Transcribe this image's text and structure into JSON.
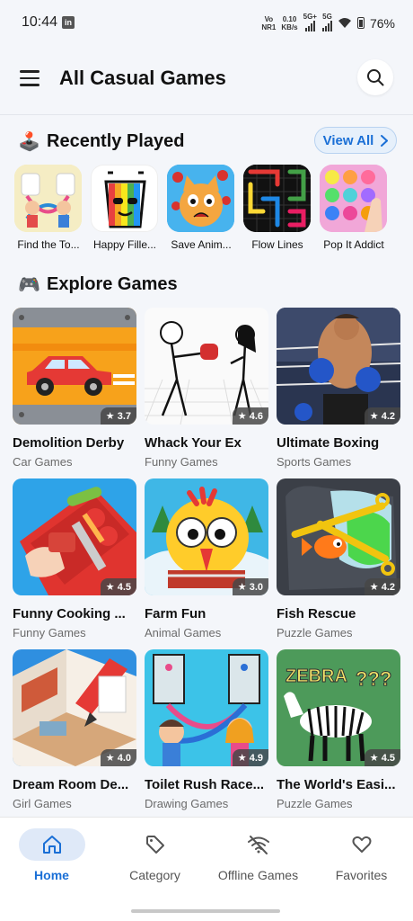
{
  "status_bar": {
    "time": "10:44",
    "app_icon": "in",
    "network_label_top": "Vo",
    "network_label_bottom": "NR1",
    "speed_top": "0.10",
    "speed_bottom": "KB/s",
    "sim1": "5G+",
    "sim2": "5G",
    "battery": "76%"
  },
  "header": {
    "title": "All Casual Games",
    "menu_icon": "hamburger-menu-icon",
    "search_icon": "search-icon"
  },
  "recently_played": {
    "emoji": "🕹️",
    "title": "Recently Played",
    "view_all_label": "View All",
    "items": [
      {
        "label": "Find the To...",
        "thumb_bg": "#f3e7a6"
      },
      {
        "label": "Happy Fille...",
        "thumb_bg": "#ffffff"
      },
      {
        "label": "Save Anim...",
        "thumb_bg": "#3aa6e8"
      },
      {
        "label": "Flow Lines",
        "thumb_bg": "#111111"
      },
      {
        "label": "Pop It Addict",
        "thumb_bg": "#f7b8e0"
      }
    ]
  },
  "explore": {
    "emoji": "🎮",
    "title": "Explore Games",
    "games": [
      {
        "title": "Demolition Derby",
        "category": "Car Games",
        "rating": "★ 3.7"
      },
      {
        "title": "Whack Your Ex",
        "category": "Funny Games",
        "rating": "★ 4.6"
      },
      {
        "title": "Ultimate Boxing",
        "category": "Sports Games",
        "rating": "★ 4.2"
      },
      {
        "title": "Funny Cooking ...",
        "category": "Funny Games",
        "rating": "★ 4.5"
      },
      {
        "title": "Farm Fun",
        "category": "Animal Games",
        "rating": "★ 3.0"
      },
      {
        "title": "Fish Rescue",
        "category": "Puzzle Games",
        "rating": "★ 4.2"
      },
      {
        "title": "Dream Room De...",
        "category": "Girl Games",
        "rating": "★ 4.0"
      },
      {
        "title": "Toilet Rush Race...",
        "category": "Drawing Games",
        "rating": "★ 4.9"
      },
      {
        "title": "The World's Easi...",
        "category": "Puzzle Games",
        "rating": "★ 4.5"
      }
    ]
  },
  "bottom_nav": {
    "items": [
      {
        "label": "Home",
        "icon": "home-icon",
        "active": true
      },
      {
        "label": "Category",
        "icon": "tag-icon",
        "active": false
      },
      {
        "label": "Offline Games",
        "icon": "wifi-off-icon",
        "active": false
      },
      {
        "label": "Favorites",
        "icon": "heart-icon",
        "active": false
      }
    ]
  },
  "colors": {
    "accent": "#1a6fd6",
    "background": "#f4f6fa"
  },
  "thumb_text": {
    "zebra": "ZEBRA",
    "question": "???"
  }
}
